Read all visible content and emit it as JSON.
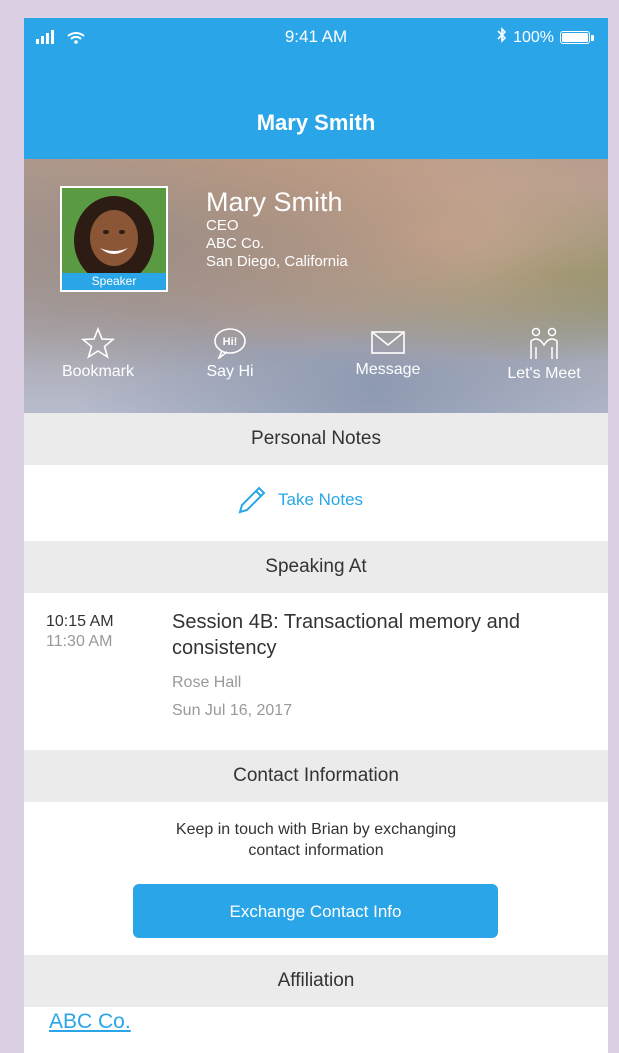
{
  "status_bar": {
    "time": "9:41 AM",
    "battery": "100%"
  },
  "header": {
    "title": "Mary Smith"
  },
  "profile": {
    "badge": "Speaker",
    "name": "Mary Smith",
    "role": "CEO",
    "company": "ABC Co.",
    "location": "San Diego, California"
  },
  "actions": [
    {
      "label": "Bookmark",
      "icon": "star-icon"
    },
    {
      "label": "Say Hi",
      "icon": "say-hi-bubble-icon"
    },
    {
      "label": "Message",
      "icon": "envelope-icon"
    },
    {
      "label": "Let's Meet",
      "icon": "people-meet-icon"
    }
  ],
  "sections": {
    "notes": "Personal Notes",
    "speaking": "Speaking At",
    "contact": "Contact Information",
    "affiliation": "Affiliation"
  },
  "notes": {
    "take_notes": "Take Notes"
  },
  "session": {
    "start": "10:15 AM",
    "end": "11:30 AM",
    "title": "Session 4B: Transactional memory and consistency",
    "room": "Rose Hall",
    "date": "Sun Jul 16, 2017"
  },
  "contact": {
    "message_line1": "Keep in touch with Brian by exchanging",
    "message_line2": "contact information",
    "button": "Exchange Contact Info"
  },
  "affiliation": {
    "link": "ABC Co."
  },
  "colors": {
    "accent": "#2aa6e8",
    "section_bg": "#ebebeb",
    "frame_bg": "#dcd1e4"
  }
}
